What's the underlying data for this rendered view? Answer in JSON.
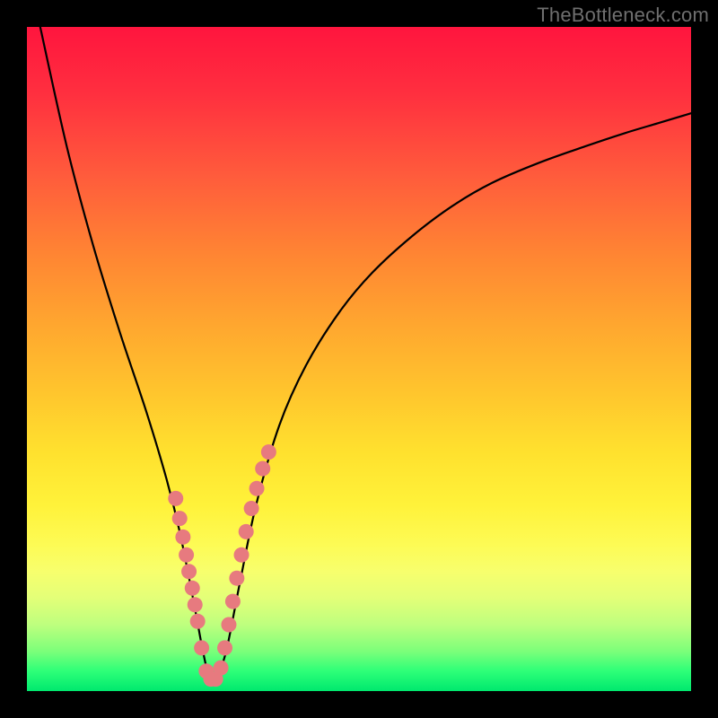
{
  "watermark": "TheBottleneck.com",
  "colors": {
    "gradient_top": "#ff153e",
    "gradient_bottom": "#00e86e",
    "curve": "#000000",
    "dots": "#e77a7f",
    "frame": "#000000"
  },
  "chart_data": {
    "type": "line",
    "title": "",
    "xlabel": "",
    "ylabel": "",
    "xlim": [
      0,
      100
    ],
    "ylim": [
      0,
      100
    ],
    "grid": false,
    "legend": false,
    "series": [
      {
        "name": "bottleneck-curve",
        "x": [
          2,
          6,
          10,
          14,
          18,
          21,
          23,
          25,
          26.5,
          27.5,
          28.5,
          30,
          32,
          34.5,
          38,
          42,
          47,
          52,
          58,
          64,
          70,
          77,
          84,
          90,
          95,
          100
        ],
        "y": [
          100,
          82,
          67,
          54,
          42,
          32,
          24,
          14,
          6,
          2,
          2,
          6,
          16,
          28,
          40,
          49,
          57,
          63,
          68.5,
          73,
          76.5,
          79.5,
          82,
          84,
          85.5,
          87
        ]
      }
    ],
    "dots_left": {
      "name": "left-cluster",
      "x": [
        22.4,
        23.0,
        23.5,
        24.0,
        24.4,
        24.9,
        25.3,
        25.7,
        26.3,
        27.0,
        27.7,
        28.4
      ],
      "y": [
        29.0,
        26.0,
        23.2,
        20.5,
        18.0,
        15.5,
        13.0,
        10.5,
        6.5,
        3.0,
        1.8,
        1.8
      ]
    },
    "dots_right": {
      "name": "right-cluster",
      "x": [
        29.2,
        29.8,
        30.4,
        31.0,
        31.6,
        32.3,
        33.0,
        33.8,
        34.6,
        35.5,
        36.4
      ],
      "y": [
        3.5,
        6.5,
        10.0,
        13.5,
        17.0,
        20.5,
        24.0,
        27.5,
        30.5,
        33.5,
        36.0
      ]
    }
  }
}
